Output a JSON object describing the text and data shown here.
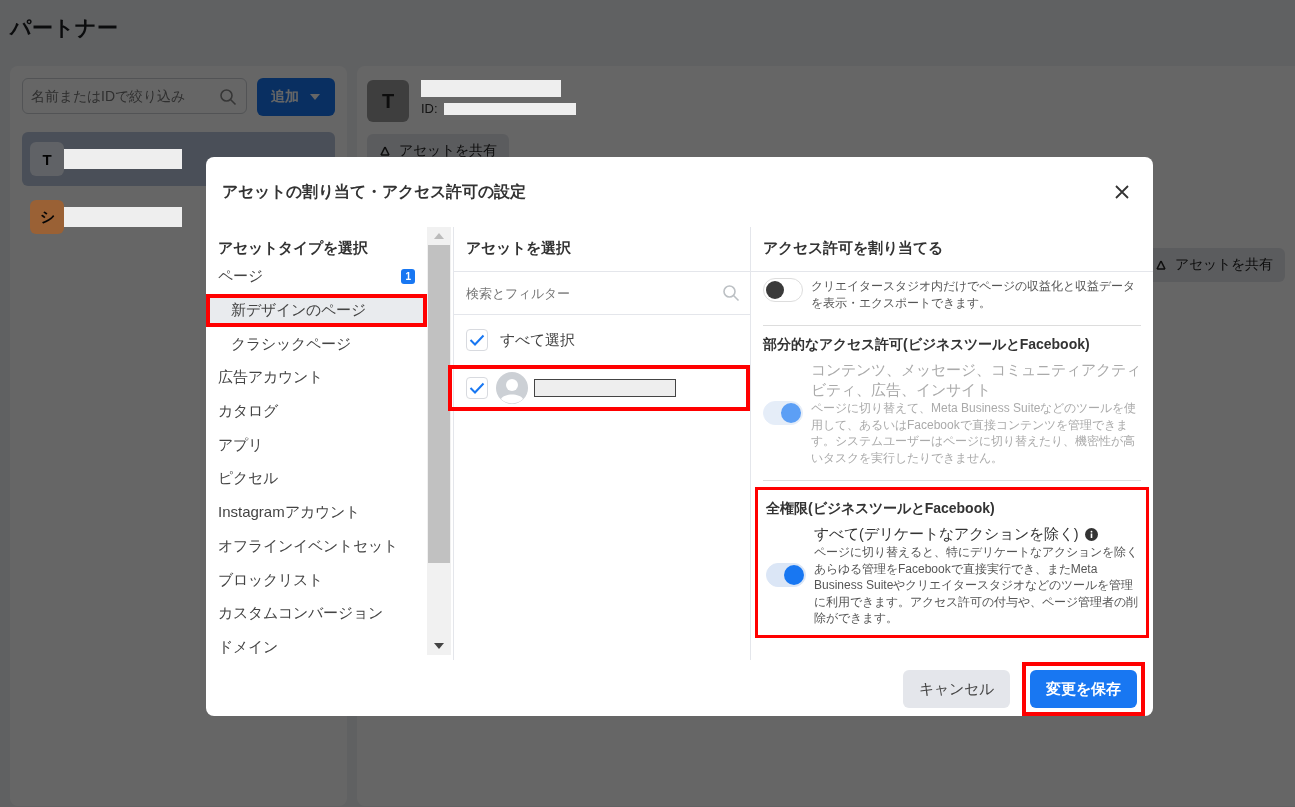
{
  "page": {
    "title": "パートナー"
  },
  "partner_list": {
    "search": {
      "placeholder": "名前またはIDで絞り込み"
    },
    "add_button": "追加",
    "items": [
      {
        "initial": "T",
        "selected": true,
        "color": "#606266"
      },
      {
        "initial": "シ",
        "selected": false,
        "color": "#9a6135"
      }
    ]
  },
  "partner_detail": {
    "initial": "T",
    "id_label": "ID:",
    "share_button": "アセットを共有",
    "side_share_button": "アセットを共有"
  },
  "dialog": {
    "title": "アセットの割り当て・アクセス許可の設定",
    "asset_types": {
      "header": "アセットタイプを選択",
      "items": [
        {
          "label": "ページ",
          "badge": "1",
          "selected": false,
          "highlighted": false,
          "children": [
            {
              "label": "新デザインのページ",
              "selected": true,
              "highlighted": true
            },
            {
              "label": "クラシックページ",
              "selected": false,
              "highlighted": false
            }
          ]
        },
        {
          "label": "広告アカウント",
          "selected": false,
          "highlighted": false
        },
        {
          "label": "カタログ",
          "selected": false,
          "highlighted": false
        },
        {
          "label": "アプリ",
          "selected": false,
          "highlighted": false
        },
        {
          "label": "ピクセル",
          "selected": false,
          "highlighted": false
        },
        {
          "label": "Instagramアカウント",
          "selected": false,
          "highlighted": false
        },
        {
          "label": "オフラインイベントセット",
          "selected": false,
          "highlighted": false
        },
        {
          "label": "ブロックリスト",
          "selected": false,
          "highlighted": false
        },
        {
          "label": "カスタムコンバージョン",
          "selected": false,
          "highlighted": false
        },
        {
          "label": "ドメイン",
          "selected": false,
          "highlighted": false
        }
      ]
    },
    "assets": {
      "header": "アセットを選択",
      "search": {
        "placeholder": "検索とフィルター"
      },
      "select_all": {
        "label": "すべて選択",
        "checked": true
      },
      "items": [
        {
          "checked": true,
          "highlighted": true
        }
      ]
    },
    "permissions": {
      "header": "アクセス許可を割り当てる",
      "items": [
        {
          "kind": "toggle",
          "on": false,
          "disabled": false,
          "highlighted": false,
          "description": "クリエイタースタジオ内だけでページの収益化と収益データを表示・エクスポートできます。"
        },
        {
          "kind": "section",
          "title": "部分的なアクセス許可(ビジネスツールとFacebook)",
          "on": true,
          "disabled": true,
          "highlighted": false,
          "summary": "コンテンツ、メッセージ、コミュニティアクティビティ、広告、インサイト",
          "description": "ページに切り替えて、Meta Business Suiteなどのツールを使用して、あるいはFacebookで直接コンテンツを管理できます。システムユーザーはページに切り替えたり、機密性が高いタスクを実行したりできません。"
        },
        {
          "kind": "section",
          "title": "全権限(ビジネスツールとFacebook)",
          "on": true,
          "disabled": false,
          "highlighted": true,
          "info": true,
          "summary": "すべて(デリケートなアクションを除く)",
          "description": "ページに切り替えると、特にデリケートなアクションを除くあらゆる管理をFacebookで直接実行でき、またMeta Business Suiteやクリエイタースタジオなどのツールを管理に利用できます。アクセス許可の付与や、ページ管理者の削除ができます。"
        }
      ]
    },
    "buttons": [
      {
        "label": "キャンセル",
        "kind": "secondary",
        "highlighted": false
      },
      {
        "label": "変更を保存",
        "kind": "primary",
        "highlighted": true
      }
    ]
  }
}
